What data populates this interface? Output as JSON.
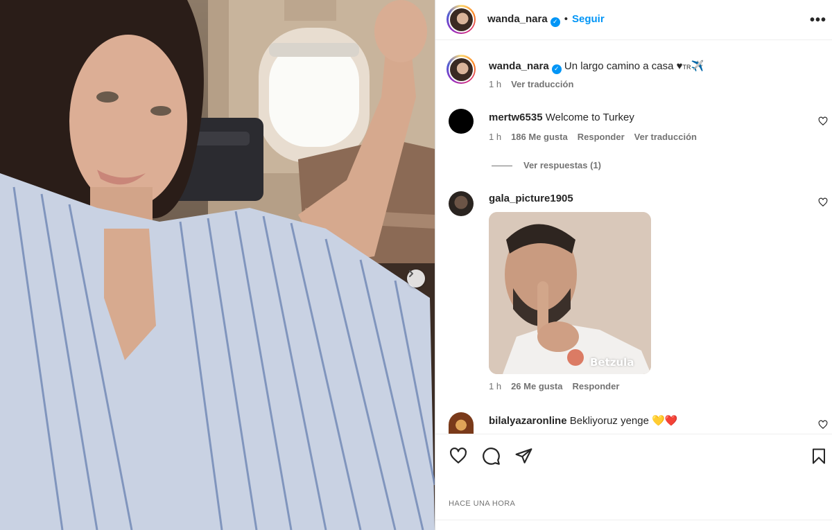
{
  "post": {
    "carousel_next_icon": "chevron-right-icon",
    "photo_alt": "selfie-in-airplane"
  },
  "header": {
    "username": "wanda_nara",
    "verified_icon": "verified-badge-icon",
    "separator": "•",
    "follow_label": "Seguir",
    "more_label": "•••"
  },
  "caption": {
    "username": "wanda_nara",
    "text": "Un largo camino a casa ♥",
    "suffix_flag": "TR",
    "suffix_emoji": "✈️",
    "time": "1 h",
    "translate": "Ver traducción"
  },
  "comments": [
    {
      "username": "mertw6535",
      "text": "Welcome to Turkey",
      "time": "1 h",
      "likes": "186 Me gusta",
      "reply": "Responder",
      "translate": "Ver traducción",
      "view_replies": "Ver respuestas (1)"
    },
    {
      "username": "gala_picture1905",
      "text": "",
      "gif_brand": "Betzula",
      "time": "1 h",
      "likes": "26 Me gusta",
      "reply": "Responder"
    },
    {
      "username": "bilalyazaronline",
      "text": "Bekliyoruz yenge",
      "emojis": "💛❤️"
    }
  ],
  "actions": {
    "like_icon": "heart-icon",
    "comment_icon": "comment-icon",
    "share_icon": "share-icon",
    "save_icon": "bookmark-icon"
  },
  "timestamp": "HACE UNA HORA",
  "colors": {
    "accent": "#0095f6",
    "text": "#262626",
    "muted": "#737373"
  }
}
